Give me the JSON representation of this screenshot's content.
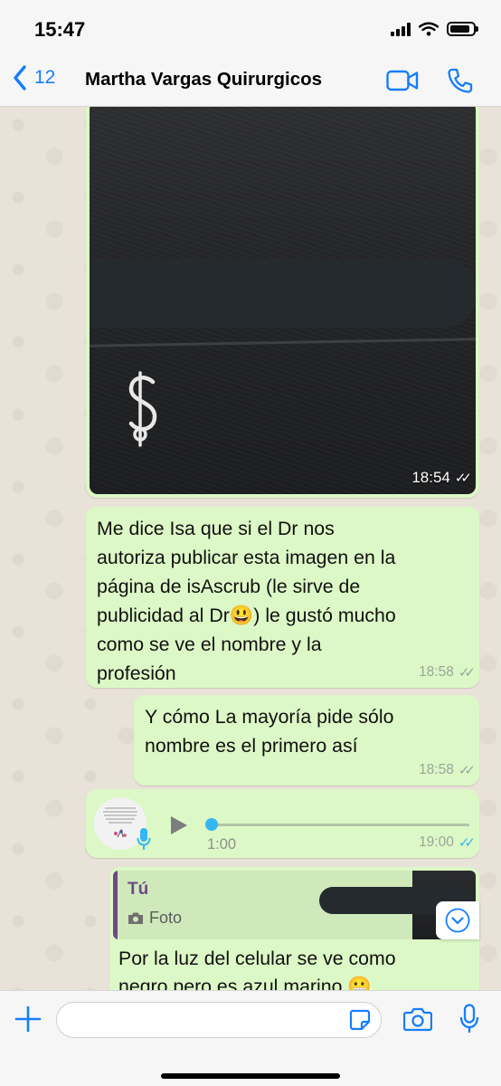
{
  "status_bar": {
    "time": "15:47"
  },
  "nav": {
    "back_count": "12",
    "contact_name": "Martha Vargas Quirurgicos"
  },
  "messages": {
    "photo": {
      "time": "18:54"
    },
    "text1": {
      "lines": [
        "Me dice Isa que si el Dr nos",
        "autoriza publicar esta imagen en la",
        "página de isAscrub (le sirve de",
        "publicidad al Dr😃) le gustó mucho",
        "como se ve el nombre y la",
        "profesión"
      ],
      "time": "18:58"
    },
    "text2": {
      "lines": [
        "Y cómo La mayoría pide sólo",
        "nombre es el primero así"
      ],
      "time": "18:58"
    },
    "voice": {
      "duration": "1:00",
      "time": "19:00",
      "progress": 0
    },
    "reply": {
      "quote_author": "Tú",
      "quote_type": "Foto",
      "lines": [
        "Por la luz del celular se ve como",
        "negro pero es azul marino 😬"
      ]
    }
  },
  "input": {
    "placeholder": ""
  },
  "colors": {
    "accent": "#157efb",
    "outgoing_bubble": "#dcf8c6",
    "read_ticks": "#34b7f1",
    "quote_author": "#6b4a87"
  },
  "icons": {
    "back": "chevron-left-icon",
    "video": "video-camera-icon",
    "phone": "phone-icon",
    "plus": "plus-icon",
    "sticker": "sticker-icon",
    "camera": "camera-icon",
    "mic": "microphone-icon",
    "scroll": "chevron-down-icon"
  }
}
